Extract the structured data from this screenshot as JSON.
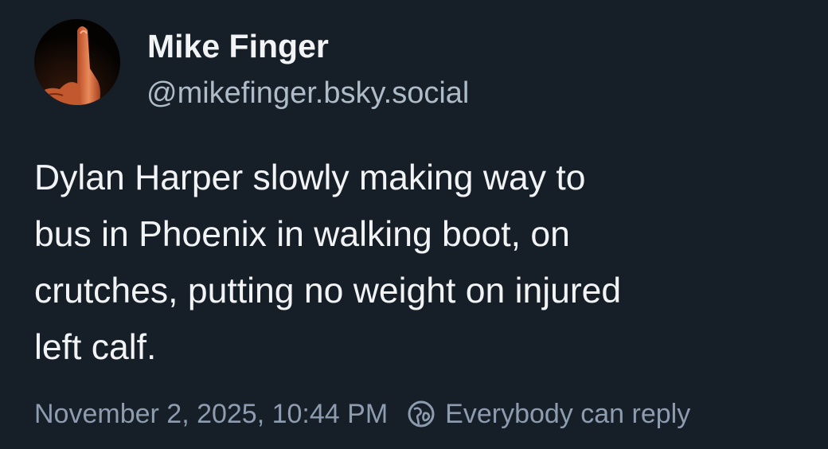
{
  "post": {
    "author": {
      "display_name": "Mike Finger",
      "handle": "@mikefinger.bsky.social"
    },
    "text_lines": [
      "Dylan Harper slowly making way to",
      "bus in Phoenix in walking boot, on",
      "crutches, putting no weight on injured",
      "left calf."
    ],
    "timestamp": "November 2, 2025, 10:44 PM",
    "reply_setting": {
      "icon": "globe-icon",
      "label": "Everybody can reply"
    }
  },
  "colors": {
    "background": "#161e27",
    "text": "#f1f3f5",
    "handle": "#aebbc9",
    "meta": "#8d9caf"
  }
}
